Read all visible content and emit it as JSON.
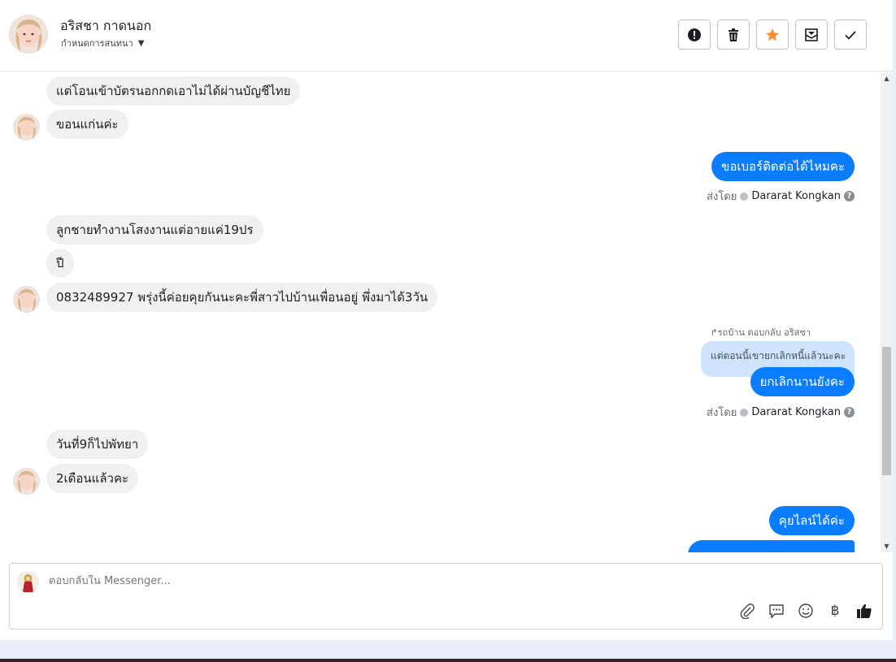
{
  "header": {
    "contact_name": "อริสชา กาดนอก",
    "assign_label": "กำหนดการสนทนา",
    "actions": [
      {
        "name": "spam-button",
        "icon": "exclamation-icon"
      },
      {
        "name": "delete-button",
        "icon": "trash-icon"
      },
      {
        "name": "star-button",
        "icon": "star-icon",
        "color": "#f7923b"
      },
      {
        "name": "mark-unread-button",
        "icon": "envelope-icon"
      },
      {
        "name": "done-button",
        "icon": "check-icon"
      }
    ]
  },
  "thread": {
    "messages": [
      {
        "dir": "in",
        "text": "แต่โอนเข้าบัตรนอกกดเอาไม่ได้ผ่านบัญชีไทย"
      },
      {
        "dir": "in",
        "text": "ขอนแก่นค่ะ"
      },
      {
        "dir": "out",
        "text": "ขอเบอร์ติดต่อได้ไหมคะ"
      },
      {
        "dir": "in",
        "text": "ลูกชายทำงานโสงงานแต่อายแค่19ปร"
      },
      {
        "dir": "in",
        "text": "ปี"
      },
      {
        "dir": "in",
        "text": "0832489927 พรุ่งนี้ค่อยคุยกันนะคะพี่สาวไปบ้านเพื่อนอยู่ พึ่งมาได้3วัน"
      },
      {
        "dir": "out",
        "text": "ยกเลิกนานยังคะ"
      },
      {
        "dir": "in",
        "text": "วันที่9ก็ไปพัทยา"
      },
      {
        "dir": "in",
        "text": "2เดือนแล้วคะ"
      },
      {
        "dir": "out",
        "text": "คุยไลน์ได้ค่ะ"
      }
    ],
    "sent_by_label": "ส่งโดย",
    "agent_name": "Dararat Kongkan",
    "reply_context": "↱รถบ้าน ตอบกลับ อริสชา",
    "quoted_text": "แต่ตอนนี้เขายกเลิกหนี้แล้วนะคะ"
  },
  "composer": {
    "placeholder": "ตอบกลับใน Messenger...",
    "tools": [
      "paperclip-icon",
      "saved-reply-icon",
      "emoji-icon",
      "baht-icon",
      "thumbs-up-icon"
    ],
    "baht_symbol": "฿"
  },
  "colors": {
    "outgoing_bubble": "#0a7cff",
    "incoming_bubble": "#f0f0f0",
    "star": "#f7923b"
  }
}
